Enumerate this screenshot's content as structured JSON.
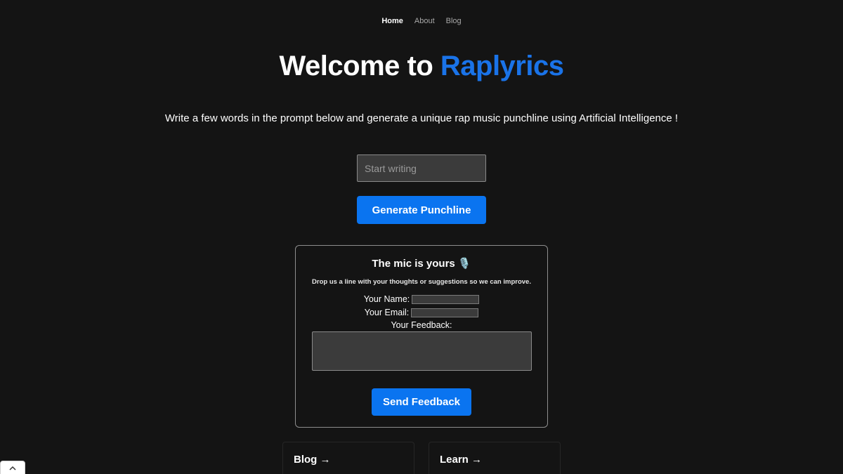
{
  "nav": {
    "items": [
      {
        "label": "Home",
        "active": true
      },
      {
        "label": "About",
        "active": false
      },
      {
        "label": "Blog",
        "active": false
      }
    ]
  },
  "hero": {
    "title_prefix": "Welcome to ",
    "title_brand": "Raplyrics",
    "subtitle": "Write a few words in the prompt below and generate a unique rap music punchline using Artificial Intelligence !"
  },
  "prompt": {
    "placeholder": "Start writing",
    "value": "",
    "button_label": "Generate Punchline"
  },
  "feedback": {
    "title": "The mic is yours 🎙️",
    "description": "Drop us a line with your thoughts or suggestions so we can improve.",
    "name_label": "Your Name:",
    "email_label": "Your Email:",
    "feedback_label": "Your Feedback:",
    "button_label": "Send Feedback"
  },
  "links": {
    "blog_label": "Blog →",
    "learn_label": "Learn →"
  },
  "scroll_icon": "chevron-up-icon",
  "colors": {
    "background": "#141414",
    "accent": "#0a74f0",
    "brand": "#1a73e8"
  }
}
